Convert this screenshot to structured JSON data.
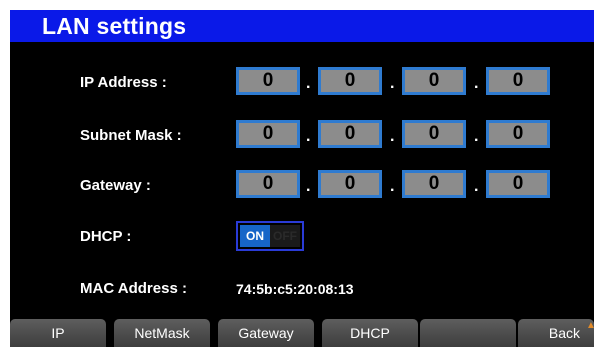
{
  "title": "LAN settings",
  "colors": {
    "title_bar": "#0a19e8",
    "field_fill": "#8c8c8c",
    "field_border": "#2f7bd0",
    "toggle_on": "#1665c8"
  },
  "fields": {
    "ip": {
      "label": "IP Address :",
      "octets": [
        "0",
        "0",
        "0",
        "0"
      ]
    },
    "netmask": {
      "label": "Subnet Mask :",
      "octets": [
        "0",
        "0",
        "0",
        "0"
      ]
    },
    "gateway": {
      "label": "Gateway :",
      "octets": [
        "0",
        "0",
        "0",
        "0"
      ]
    }
  },
  "separator": ".",
  "dhcp": {
    "label": "DHCP :",
    "on_text": "ON",
    "off_text": "OFF",
    "state": "ON"
  },
  "mac": {
    "label": "MAC Address :",
    "value": "74:5b:c5:20:08:13"
  },
  "softkeys": [
    {
      "label": "IP"
    },
    {
      "label": "NetMask"
    },
    {
      "label": "Gateway"
    },
    {
      "label": "DHCP"
    },
    {
      "label": ""
    },
    {
      "label": "Back"
    }
  ],
  "icons": {
    "more": "triangle-up-icon"
  }
}
